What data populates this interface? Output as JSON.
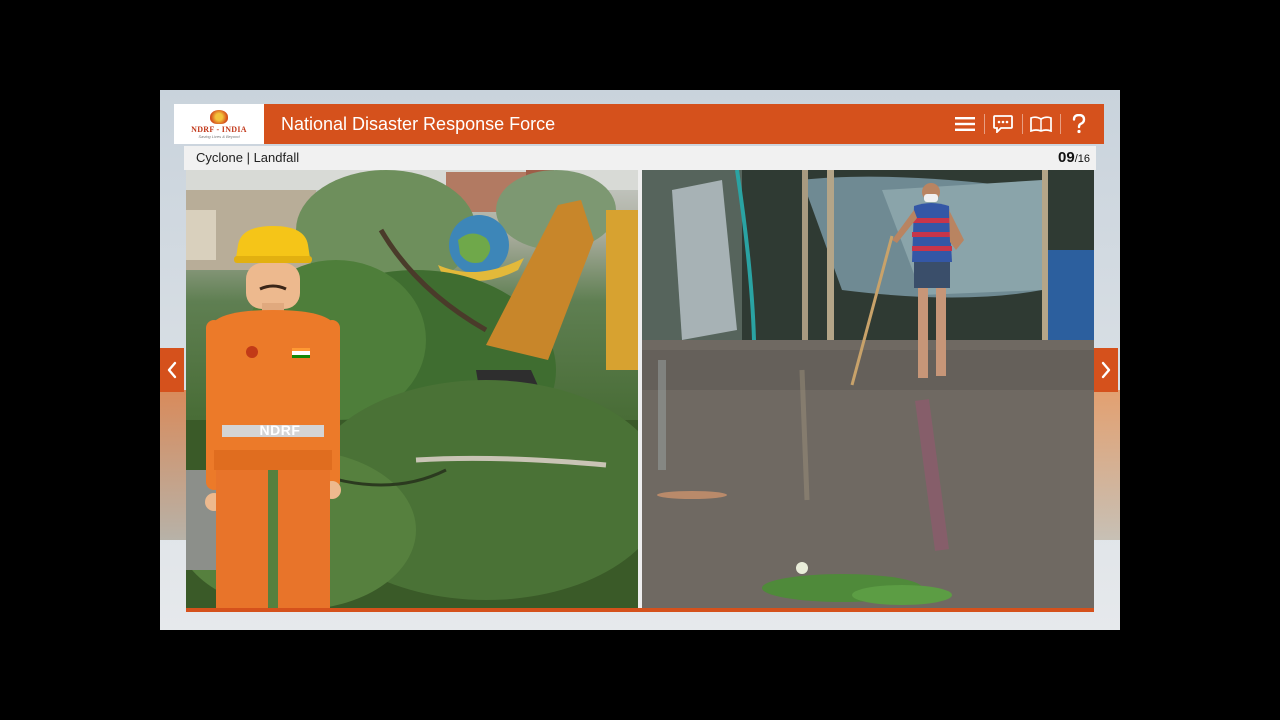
{
  "header": {
    "logo_text": "NDRF - INDIA",
    "logo_tagline": "Saving Lives & Beyond",
    "title": "National Disaster Response Force",
    "icons": [
      "menu-icon",
      "chat-icon",
      "book-icon",
      "help-icon"
    ]
  },
  "subheader": {
    "breadcrumb": "Cyclone | Landfall",
    "page_current": "09",
    "page_total": "/16"
  },
  "character": {
    "badge_text": "NDRF"
  },
  "colors": {
    "accent": "#d5511c",
    "header_text": "#ffffff",
    "subbar_bg": "#f1f1f1"
  }
}
